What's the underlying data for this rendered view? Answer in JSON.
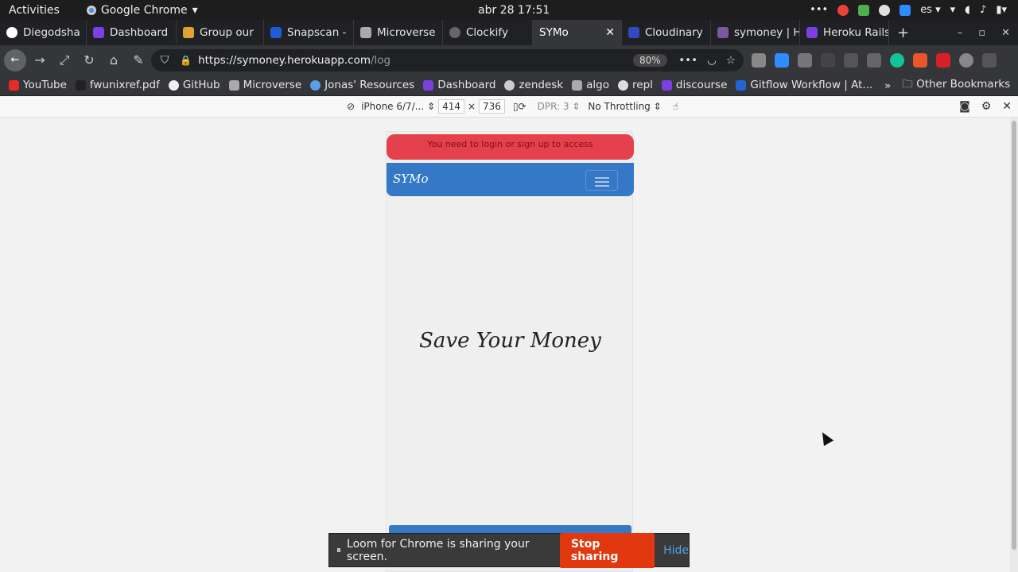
{
  "system": {
    "activities": "Activities",
    "app_name": "Google Chrome",
    "app_dropdown": "▾",
    "clock": "abr 28  17:51",
    "language": "es ▾"
  },
  "tabs": [
    {
      "label": "Diegodsha",
      "color": "#ffffff"
    },
    {
      "label": "Dashboard",
      "color": "#7b3fe4"
    },
    {
      "label": "Group our",
      "color": "#e2a233"
    },
    {
      "label": "Snapscan -",
      "color": "#1f5bd8"
    },
    {
      "label": "Microverse",
      "color": "#aaaaaa"
    },
    {
      "label": "Clockify",
      "color": "#666666"
    },
    {
      "label": "SYMo",
      "color": "#35363a"
    },
    {
      "label": "Cloudinary",
      "color": "#3448c5"
    },
    {
      "label": "symoney | H",
      "color": "#79589f"
    },
    {
      "label": "Heroku Rails",
      "color": "#7b3fe4"
    }
  ],
  "active_tab_close": "✕",
  "new_tab": "+",
  "window_controls": [
    "–",
    "▫",
    "✕"
  ],
  "address": {
    "host": "https://symoney.herokuapp.com",
    "path": "/log",
    "zoom": "80%"
  },
  "bookmarks": [
    {
      "label": "YouTube",
      "color": "#e52d27"
    },
    {
      "label": "fwunixref.pdf",
      "color": "#222222"
    },
    {
      "label": "GitHub",
      "color": "#f0f0f0"
    },
    {
      "label": "Microverse",
      "color": "#aaaaaa"
    },
    {
      "label": "Jonas' Resources",
      "color": "#5aa0e8"
    },
    {
      "label": "Dashboard",
      "color": "#7b3fe4"
    },
    {
      "label": "zendesk",
      "color": "#cccccc"
    },
    {
      "label": "algo",
      "color": "#aaaaaa"
    },
    {
      "label": "repl",
      "color": "#dddddd"
    },
    {
      "label": "discourse",
      "color": "#7b3fe4"
    },
    {
      "label": "Gitflow Workflow | At...",
      "color": "#2465d6"
    }
  ],
  "bookmarks_more": "»",
  "other_bookmarks": "Other Bookmarks",
  "devtools": {
    "device": "iPhone 6/7/...",
    "width": "414",
    "times": "×",
    "height": "736",
    "dpr": "DPR: 3",
    "throttling": "No Throttling"
  },
  "page": {
    "alert": "You need to login or sign up to access",
    "brand": "SYMo",
    "hero": "Save Your Money"
  },
  "loom": {
    "message": "Loom for Chrome is sharing your screen.",
    "stop": "Stop sharing",
    "hide": "Hide"
  }
}
